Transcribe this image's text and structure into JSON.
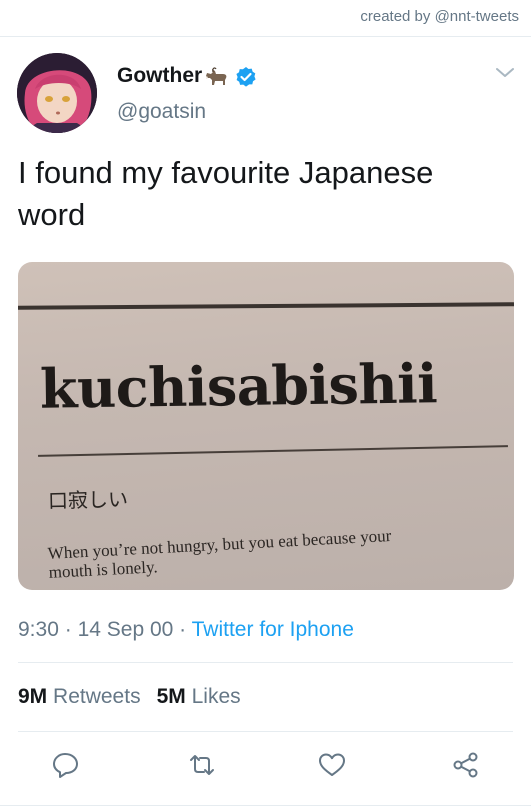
{
  "header": {
    "created_by": "created by @nnt-tweets"
  },
  "author": {
    "display_name": "Gowther",
    "handle": "@goatsin",
    "name_emoji": "goat-icon",
    "verified_badge": "verified-icon"
  },
  "tweet": {
    "text": "I found my favourite Japanese word",
    "media": {
      "headword": "kuchisabishii",
      "japanese": "口寂しい",
      "definition": "When you’re not hungry, but you eat because your mouth is lonely."
    },
    "time": "9:30",
    "separator": "·",
    "date": "14 Sep 00",
    "source": "Twitter for Iphone"
  },
  "stats": {
    "retweets_count": "9M",
    "retweets_label": "Retweets",
    "likes_count": "5M",
    "likes_label": "Likes"
  },
  "actions": [
    "reply-icon",
    "retweet-icon",
    "like-icon",
    "share-icon"
  ],
  "colors": {
    "link": "#1da1f2",
    "secondary_text": "#657786",
    "primary_text": "#14171a",
    "divider": "#e6ecf0"
  }
}
